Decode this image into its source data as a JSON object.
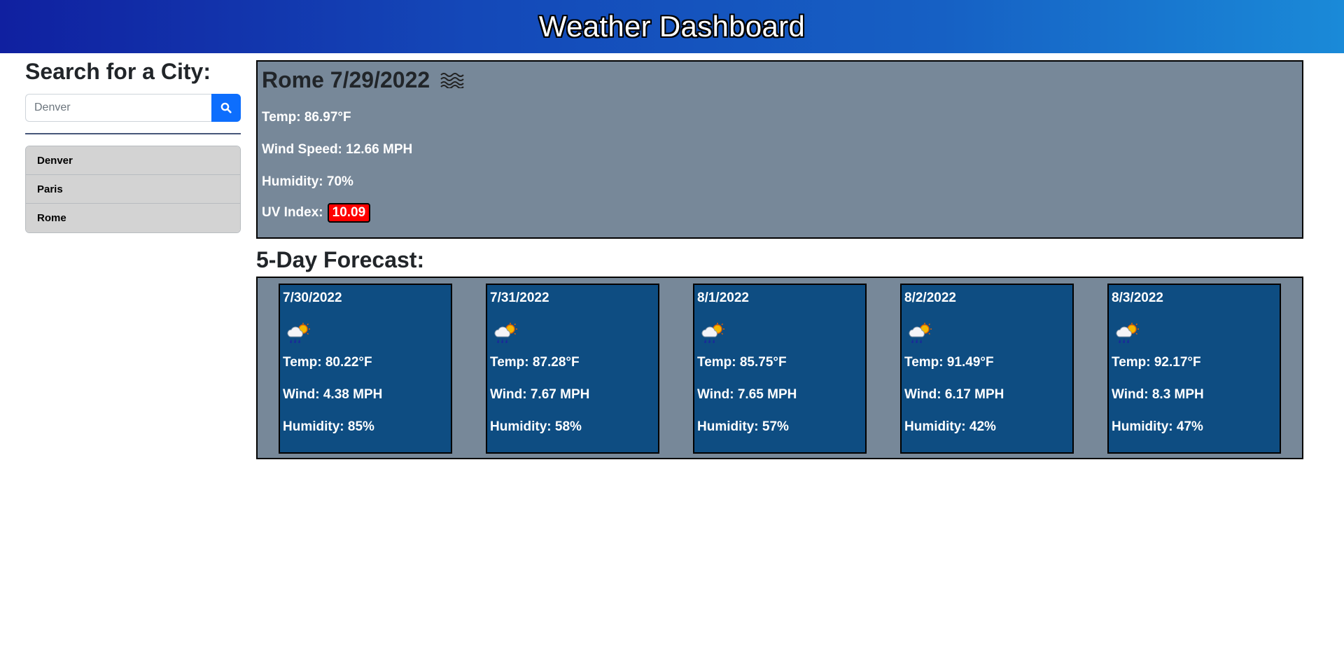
{
  "header": {
    "title": "Weather Dashboard"
  },
  "sidebar": {
    "title": "Search for a City:",
    "search": {
      "placeholder": "Denver",
      "value": "",
      "button_icon": "search-icon"
    },
    "history": [
      "Denver",
      "Paris",
      "Rome"
    ]
  },
  "current": {
    "title": "Rome 7/29/2022",
    "icon": "mist-icon",
    "temp": "Temp: 86.97°F",
    "wind": "Wind Speed: 12.66 MPH",
    "humidity": "Humidity: 70%",
    "uv_label": "UV Index:",
    "uv_value": "10.09",
    "uv_color": "#ff0000"
  },
  "forecast": {
    "title": "5-Day Forecast:",
    "days": [
      {
        "date": "7/30/2022",
        "icon": "rain-sun-icon",
        "temp": "Temp: 80.22°F",
        "wind": "Wind: 4.38 MPH",
        "humidity": "Humidity: 85%"
      },
      {
        "date": "7/31/2022",
        "icon": "rain-sun-icon",
        "temp": "Temp: 87.28°F",
        "wind": "Wind: 7.67 MPH",
        "humidity": "Humidity: 58%"
      },
      {
        "date": "8/1/2022",
        "icon": "rain-sun-icon",
        "temp": "Temp: 85.75°F",
        "wind": "Wind: 7.65 MPH",
        "humidity": "Humidity: 57%"
      },
      {
        "date": "8/2/2022",
        "icon": "rain-sun-icon",
        "temp": "Temp: 91.49°F",
        "wind": "Wind: 6.17 MPH",
        "humidity": "Humidity: 42%"
      },
      {
        "date": "8/3/2022",
        "icon": "rain-sun-icon",
        "temp": "Temp: 92.17°F",
        "wind": "Wind: 8.3 MPH",
        "humidity": "Humidity: 47%"
      }
    ]
  },
  "colors": {
    "panel_bg": "#778899",
    "card_bg": "#0e4d82",
    "search_button": "#0d6efd",
    "history_item_bg": "#d3d3d3"
  }
}
